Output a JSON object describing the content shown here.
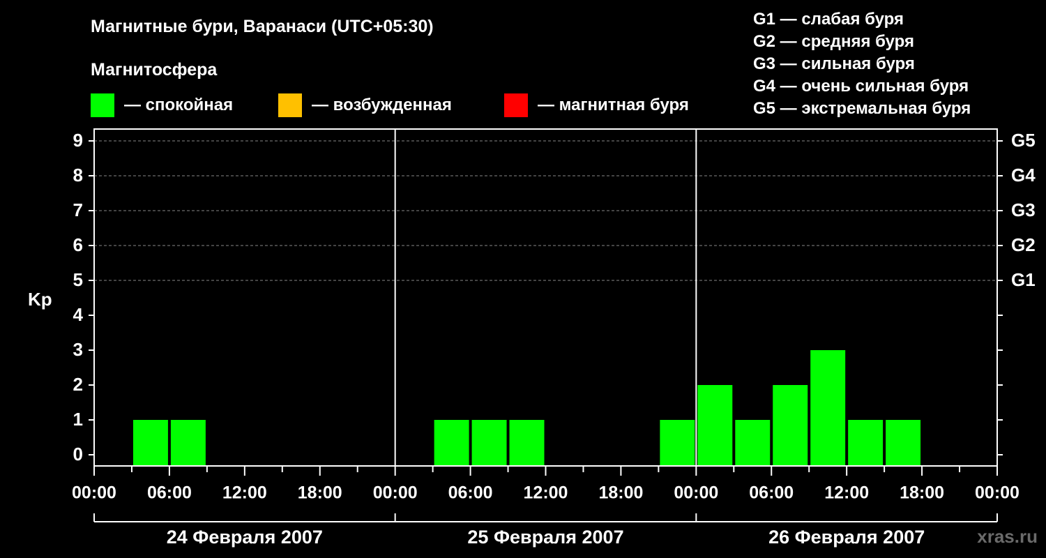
{
  "title": "Магнитные бури, Варанаси (UTC+05:30)",
  "subtitle": "Магнитосфера",
  "legend": [
    {
      "label": "— спокойная",
      "color": "#00ff00"
    },
    {
      "label": "— возбужденная",
      "color": "#ffc000"
    },
    {
      "label": "— магнитная буря",
      "color": "#ff0000"
    }
  ],
  "g_scale": [
    "G1 — слабая буря",
    "G2 — средняя буря",
    "G3 — сильная буря",
    "G4 — очень сильная буря",
    "G5 — экстремальная буря"
  ],
  "watermark": "xras.ru",
  "chart_data": {
    "type": "bar",
    "ylabel": "Kp",
    "ylim": [
      0,
      9
    ],
    "y_ticks": [
      0,
      1,
      2,
      3,
      4,
      5,
      6,
      7,
      8,
      9
    ],
    "right_ticks": [
      {
        "value": 5,
        "label": "G1"
      },
      {
        "value": 6,
        "label": "G2"
      },
      {
        "value": 7,
        "label": "G3"
      },
      {
        "value": 8,
        "label": "G4"
      },
      {
        "value": 9,
        "label": "G5"
      }
    ],
    "x_tick_labels": [
      "00:00",
      "06:00",
      "12:00",
      "18:00",
      "00:00",
      "06:00",
      "12:00",
      "18:00",
      "00:00",
      "06:00",
      "12:00",
      "18:00",
      "00:00"
    ],
    "days": [
      "24 Февраля 2007",
      "25 Февраля 2007",
      "26 Февраля 2007"
    ],
    "interval_hours": 3,
    "grid": true,
    "colors": {
      "quiet": "#00ff00",
      "active": "#ffc000",
      "storm": "#ff0000"
    },
    "series": [
      {
        "day": "24 Февраля 2007",
        "kp": [
          0,
          1,
          1,
          0,
          0,
          0,
          0,
          0
        ]
      },
      {
        "day": "25 Февраля 2007",
        "kp": [
          0,
          1,
          1,
          1,
          0,
          0,
          0,
          1
        ]
      },
      {
        "day": "26 Февраля 2007",
        "kp": [
          2,
          1,
          2,
          3,
          1,
          1,
          0,
          0
        ]
      }
    ]
  }
}
